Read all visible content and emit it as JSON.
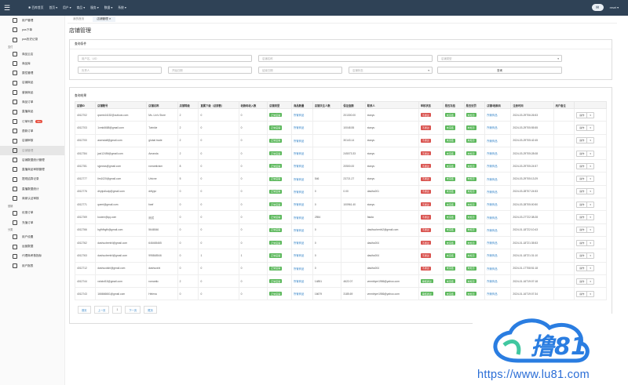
{
  "topbar": {
    "nav": [
      "✱ 百库首页",
      "首页 ▾",
      "用户 ▾",
      "商品 ▾",
      "服务 ▾",
      "数据 ▾",
      "系统 ▾"
    ],
    "user": "reset ▾"
  },
  "sidebar": {
    "items": [
      {
        "label": "用户管理"
      },
      {
        "label": "pos下单"
      },
      {
        "label": "pos历史记录"
      },
      {
        "group": "支付"
      },
      {
        "label": "商品云店"
      },
      {
        "label": "商品库"
      },
      {
        "label": "属性管理"
      },
      {
        "label": "店铺商品"
      },
      {
        "label": "营销商品"
      },
      {
        "label": "商品订单"
      },
      {
        "label": "直播商品"
      },
      {
        "label": "订单列表",
        "badge": "99+"
      },
      {
        "label": "退款订单"
      },
      {
        "label": "店铺审核"
      },
      {
        "label": "店铺管理",
        "active": true
      },
      {
        "label": "店铺数据统计管理"
      },
      {
        "label": "直播商品审核管理"
      },
      {
        "label": "提现结算记录"
      },
      {
        "label": "直播数据统计"
      },
      {
        "label": "商家认证审核"
      },
      {
        "group": "营销"
      },
      {
        "label": "优惠订单"
      },
      {
        "label": "充值订单"
      },
      {
        "group": "分类"
      },
      {
        "label": "用户设置"
      },
      {
        "label": "运营数据"
      },
      {
        "label": "代理商考核指标"
      },
      {
        "label": "用户报表"
      }
    ]
  },
  "tabs": [
    {
      "label": "我的首页"
    },
    {
      "label": "店铺管理 ✕",
      "active": true
    }
  ],
  "page_title": "店铺管理",
  "search": {
    "header": "查询条件",
    "fields": {
      "user_id": "用户名、UID",
      "store_name": "店铺名称",
      "store_type": "店铺类型",
      "owner": "负责人",
      "start_date": "开始日期",
      "end_date": "结束日期",
      "status": "店铺状态"
    },
    "button": "查询"
  },
  "results": {
    "header": "查询结果",
    "columns": [
      "店铺ID",
      "店铺账号",
      "店铺名称",
      "店铺等级",
      "直属下级（总销售）",
      "收款码收入数",
      "店铺类型",
      "商品数量",
      "店铺关注人数",
      "保证金额",
      "联系人",
      "审核状态",
      "是否冻结",
      "是否处罚",
      "店铺/收款码",
      "注册时间",
      "用户备注",
      ""
    ],
    "rows": [
      {
        "id": "4012702",
        "account": "qsemi44152@outlook.com",
        "name": "Ms. Lin's Store",
        "level": "2",
        "sub": "0",
        "income": "0",
        "fans": "",
        "margin": "201300.00",
        "contact": "xianyu",
        "audit": "不通过",
        "time": "2024-03-29T06:26:53"
      },
      {
        "id": "4012703",
        "account": "1xmk6688@gmail.com",
        "name": "Twinkle",
        "level": "2",
        "sub": "0",
        "income": "0",
        "fans": "",
        "margin": "10048.55",
        "contact": "xianyu",
        "audit": "不通过",
        "time": "2024-03-29T05:55:55"
      },
      {
        "id": "4012700",
        "account": "asensiafl@gmail.com",
        "name": "global trade",
        "level": "2",
        "sub": "0",
        "income": "0",
        "fans": "",
        "margin": "30143.14",
        "contact": "xianyu",
        "audit": "不通过",
        "time": "2024-03-29T05:42:45"
      },
      {
        "id": "4012784",
        "account": "jaxi12456@gmail.com",
        "name": "Amanda",
        "level": "2",
        "sub": "0",
        "income": "0",
        "fans": "",
        "margin": "245073.33",
        "contact": "xianyu",
        "audit": "不通过",
        "time": "2024-03-29T05:28:08"
      },
      {
        "id": "4012781",
        "account": "sjpneas@gmail.com",
        "name": "romanticism",
        "level": "8",
        "sub": "0",
        "income": "0",
        "fans": "",
        "margin": "20500.00",
        "contact": "xianyu",
        "audit": "不通过",
        "time": "2024-03-29T05:24:57"
      },
      {
        "id": "4012777",
        "account": "lim1020@gmail.com",
        "name": "Unicne",
        "level": "5",
        "sub": "0",
        "income": "0",
        "fans": "546",
        "margin": "23721.27",
        "contact": "xianyu",
        "audit": "不通过",
        "time": "2024-03-29T05:13:29"
      },
      {
        "id": "4012776",
        "account": "dhytpdludp@gmail.com",
        "name": "drftyjui",
        "level": "0",
        "sub": "0",
        "income": "0",
        "fans": "0",
        "margin": "0.00",
        "contact": "dasihu001",
        "audit": "不通过",
        "time": "2024-03-28T07:24:53"
      },
      {
        "id": "4012771",
        "account": "qwmt@gmail.com",
        "name": "fwef",
        "level": "0",
        "sub": "0",
        "income": "0",
        "fans": "0",
        "margin": "100961.40",
        "contact": "xianyu",
        "audit": "不通过",
        "time": "2024-03-28T05:00:50"
      },
      {
        "id": "4012769",
        "account": "kuoinn@qq.com",
        "name": "测试",
        "level": "0",
        "sub": "0",
        "income": "0",
        "fans": "2554",
        "margin": "",
        "contact": "fasda",
        "audit": "不通过",
        "time": "2024-03-27T22:38:28"
      },
      {
        "id": "4012766",
        "account": "hgfhfhgfh@gmail.com",
        "name": "5646546",
        "level": "0",
        "sub": "0",
        "income": "0",
        "fans": "0",
        "margin": "",
        "contact": "dasihuchenhi2@gmail.com",
        "audit": "不通过",
        "time": "2024-01-18T22:10:43"
      },
      {
        "id": "4012762",
        "account": "dashucbenhii@gmail.com",
        "name": "646465465",
        "level": "0",
        "sub": "0",
        "income": "0",
        "fans": "0",
        "margin": "",
        "contact": "dasihu004",
        "audit": "不通过",
        "time": "2024-01-18T21:35:53"
      },
      {
        "id": "4012763",
        "account": "dashucbenhii@gmail.com",
        "name": "995848546",
        "level": "0",
        "sub": "1",
        "income": "1",
        "fans": "0",
        "margin": "",
        "contact": "dasihu004",
        "audit": "不通过",
        "time": "2024-01-18T21:31:10"
      },
      {
        "id": "4012712",
        "account": "dashucdshi@gmail.com",
        "name": "dashucshi",
        "level": "0",
        "sub": "0",
        "income": "0",
        "fans": "0",
        "margin": "",
        "contact": "dasihu004",
        "audit": "不通过",
        "time": "2024-01-17T08:51:18"
      },
      {
        "id": "4012744",
        "account": "vshdsf15@gmail.com",
        "name": "romantic",
        "level": "2",
        "sub": "0",
        "income": "0",
        "fans": "14851",
        "margin": "4622.07",
        "contact": "vmmbiyer1986@yahoo.com",
        "audit": "审核通过",
        "time": "2024-01-16T19:07:18"
      },
      {
        "id": "4012743",
        "account": "166666661@gmail.com",
        "name": "Helena",
        "level": "0",
        "sub": "0",
        "income": "0",
        "fans": "16679",
        "margin": "3185.69",
        "contact": "vmmbiyer1986@yahoo.com",
        "audit": "审核通过",
        "time": "2024-01-16T19:07:34"
      }
    ],
    "labels": {
      "store_type": "正常店铺",
      "goods": "所管商品",
      "frozen": "未冻结",
      "punish": "未处罚",
      "code": "所管商品",
      "op": "操作"
    }
  },
  "pagination": [
    "首页",
    "上一页",
    "1",
    "下一页",
    "尾页"
  ],
  "watermark": {
    "logo_text": "撸81",
    "url": "https://www.lu81.com"
  },
  "colors": {
    "topbar": "#2f4256",
    "green": "#5cb85c",
    "red": "#d9534f",
    "link": "#3a87c9"
  }
}
